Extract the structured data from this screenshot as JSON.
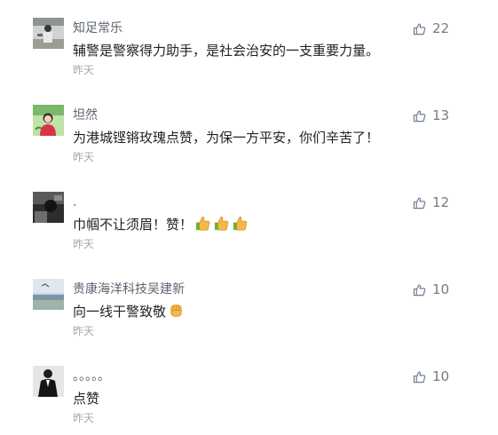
{
  "comments": [
    {
      "username": "知足常乐",
      "content": "辅警是警察得力助手，是社会治安的一支重要力量。",
      "time": "昨天",
      "likes": "22"
    },
    {
      "username": "坦然",
      "content": "为港城铿锵玫瑰点赞，为保一方平安，你们辛苦了！",
      "time": "昨天",
      "likes": "13"
    },
    {
      "username": ".",
      "content": "巾帼不让须眉！赞！",
      "time": "昨天",
      "likes": "12"
    },
    {
      "username": "贵康海洋科技吴建新",
      "content": "向一线干警致敬",
      "time": "昨天",
      "likes": "10"
    },
    {
      "username": "。。。。。",
      "content": "点赞",
      "time": "昨天",
      "likes": "10"
    }
  ],
  "icons": {
    "like": "thumbs-up-outline-icon",
    "emoji_thumbs": "thumbs-up-emoji-icon",
    "emoji_fist": "raised-fist-emoji-icon"
  },
  "colors": {
    "username": "#5b6470",
    "content": "#222222",
    "time": "#a7a7a7",
    "like_icon": "#6f7d93",
    "like_count": "#7a7a7a"
  }
}
